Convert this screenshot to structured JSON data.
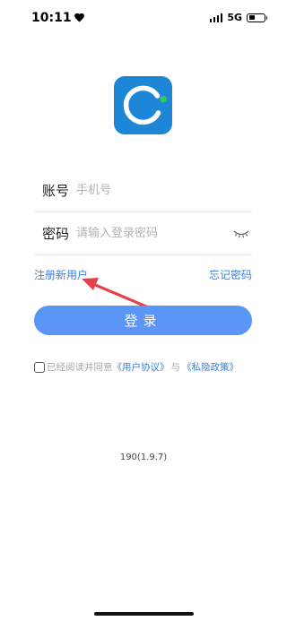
{
  "status_bar": {
    "time": "10:11",
    "network": "5G",
    "battery_level": 0.45
  },
  "form": {
    "account_label": "账号",
    "account_placeholder": "手机号",
    "password_label": "密码",
    "password_placeholder": "请输入登录密码"
  },
  "links": {
    "register": "注册新用户",
    "forgot_password": "忘记密码"
  },
  "login_button": "登录",
  "agreement": {
    "prefix": "已经阅读并同意",
    "user_agreement": "《用户协议》",
    "conjunction": "与",
    "privacy_policy": "《私隐政策》"
  },
  "version": "190(1.9.7)",
  "colors": {
    "brand_blue": "#1d86d6",
    "accent_green": "#34c759",
    "button_blue": "#5b95f5",
    "link_blue": "#3c82dc",
    "annotation_red": "#e8404a"
  }
}
